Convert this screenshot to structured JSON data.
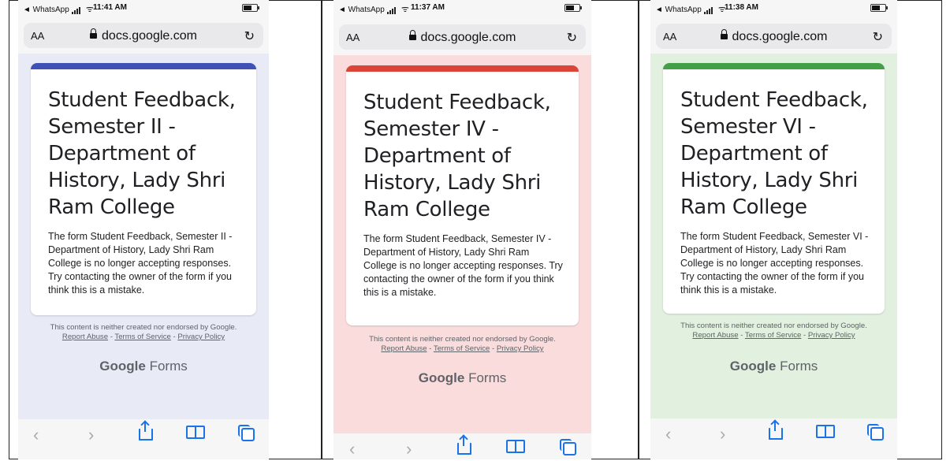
{
  "screens": [
    {
      "status": {
        "back_label": "◄ WhatsApp",
        "time": "11:41 AM"
      },
      "browser": {
        "text_size": "AA",
        "host": "docs.google.com"
      },
      "form": {
        "title": "Student Feedback, Semester II - Department of History, Lady Shri Ram College",
        "message": "The form Student Feedback, Semester II - Department of History, Lady Shri Ram College is no longer accepting responses. Try contacting the owner of the form if you think this is a mistake."
      },
      "colors": {
        "accent": "#3f51b5",
        "background": "#e8eaf6"
      }
    },
    {
      "status": {
        "back_label": "◄ WhatsApp",
        "time": "11:37 AM"
      },
      "browser": {
        "text_size": "AA",
        "host": "docs.google.com"
      },
      "form": {
        "title": "Student Feedback, Semester IV - Department of History, Lady Shri Ram College",
        "message": "The form Student Feedback, Semester IV - Department of History, Lady Shri Ram College is no longer accepting responses. Try contacting the owner of the form if you think this is a mistake."
      },
      "colors": {
        "accent": "#db4437",
        "background": "#fadcdc"
      }
    },
    {
      "status": {
        "back_label": "◄ WhatsApp",
        "time": "11:38 AM"
      },
      "browser": {
        "text_size": "AA",
        "host": "docs.google.com"
      },
      "form": {
        "title": "Student Feedback, Semester VI - Department of History, Lady Shri Ram College",
        "message": "The form Student Feedback, Semester VI - Department of History, Lady Shri Ram College is no longer accepting responses. Try contacting the owner of the form if you think this is a mistake."
      },
      "colors": {
        "accent": "#43a047",
        "background": "#e2f0e0"
      }
    }
  ],
  "footer": {
    "disclaimer": "This content is neither created nor endorsed by Google.",
    "report_abuse": "Report Abuse",
    "terms": "Terms of Service",
    "privacy": "Privacy Policy",
    "separator": " - ",
    "brand_google": "Google",
    "brand_forms": "Forms"
  },
  "toolbar": {
    "back": "‹",
    "forward": "›",
    "reload": "↻"
  }
}
